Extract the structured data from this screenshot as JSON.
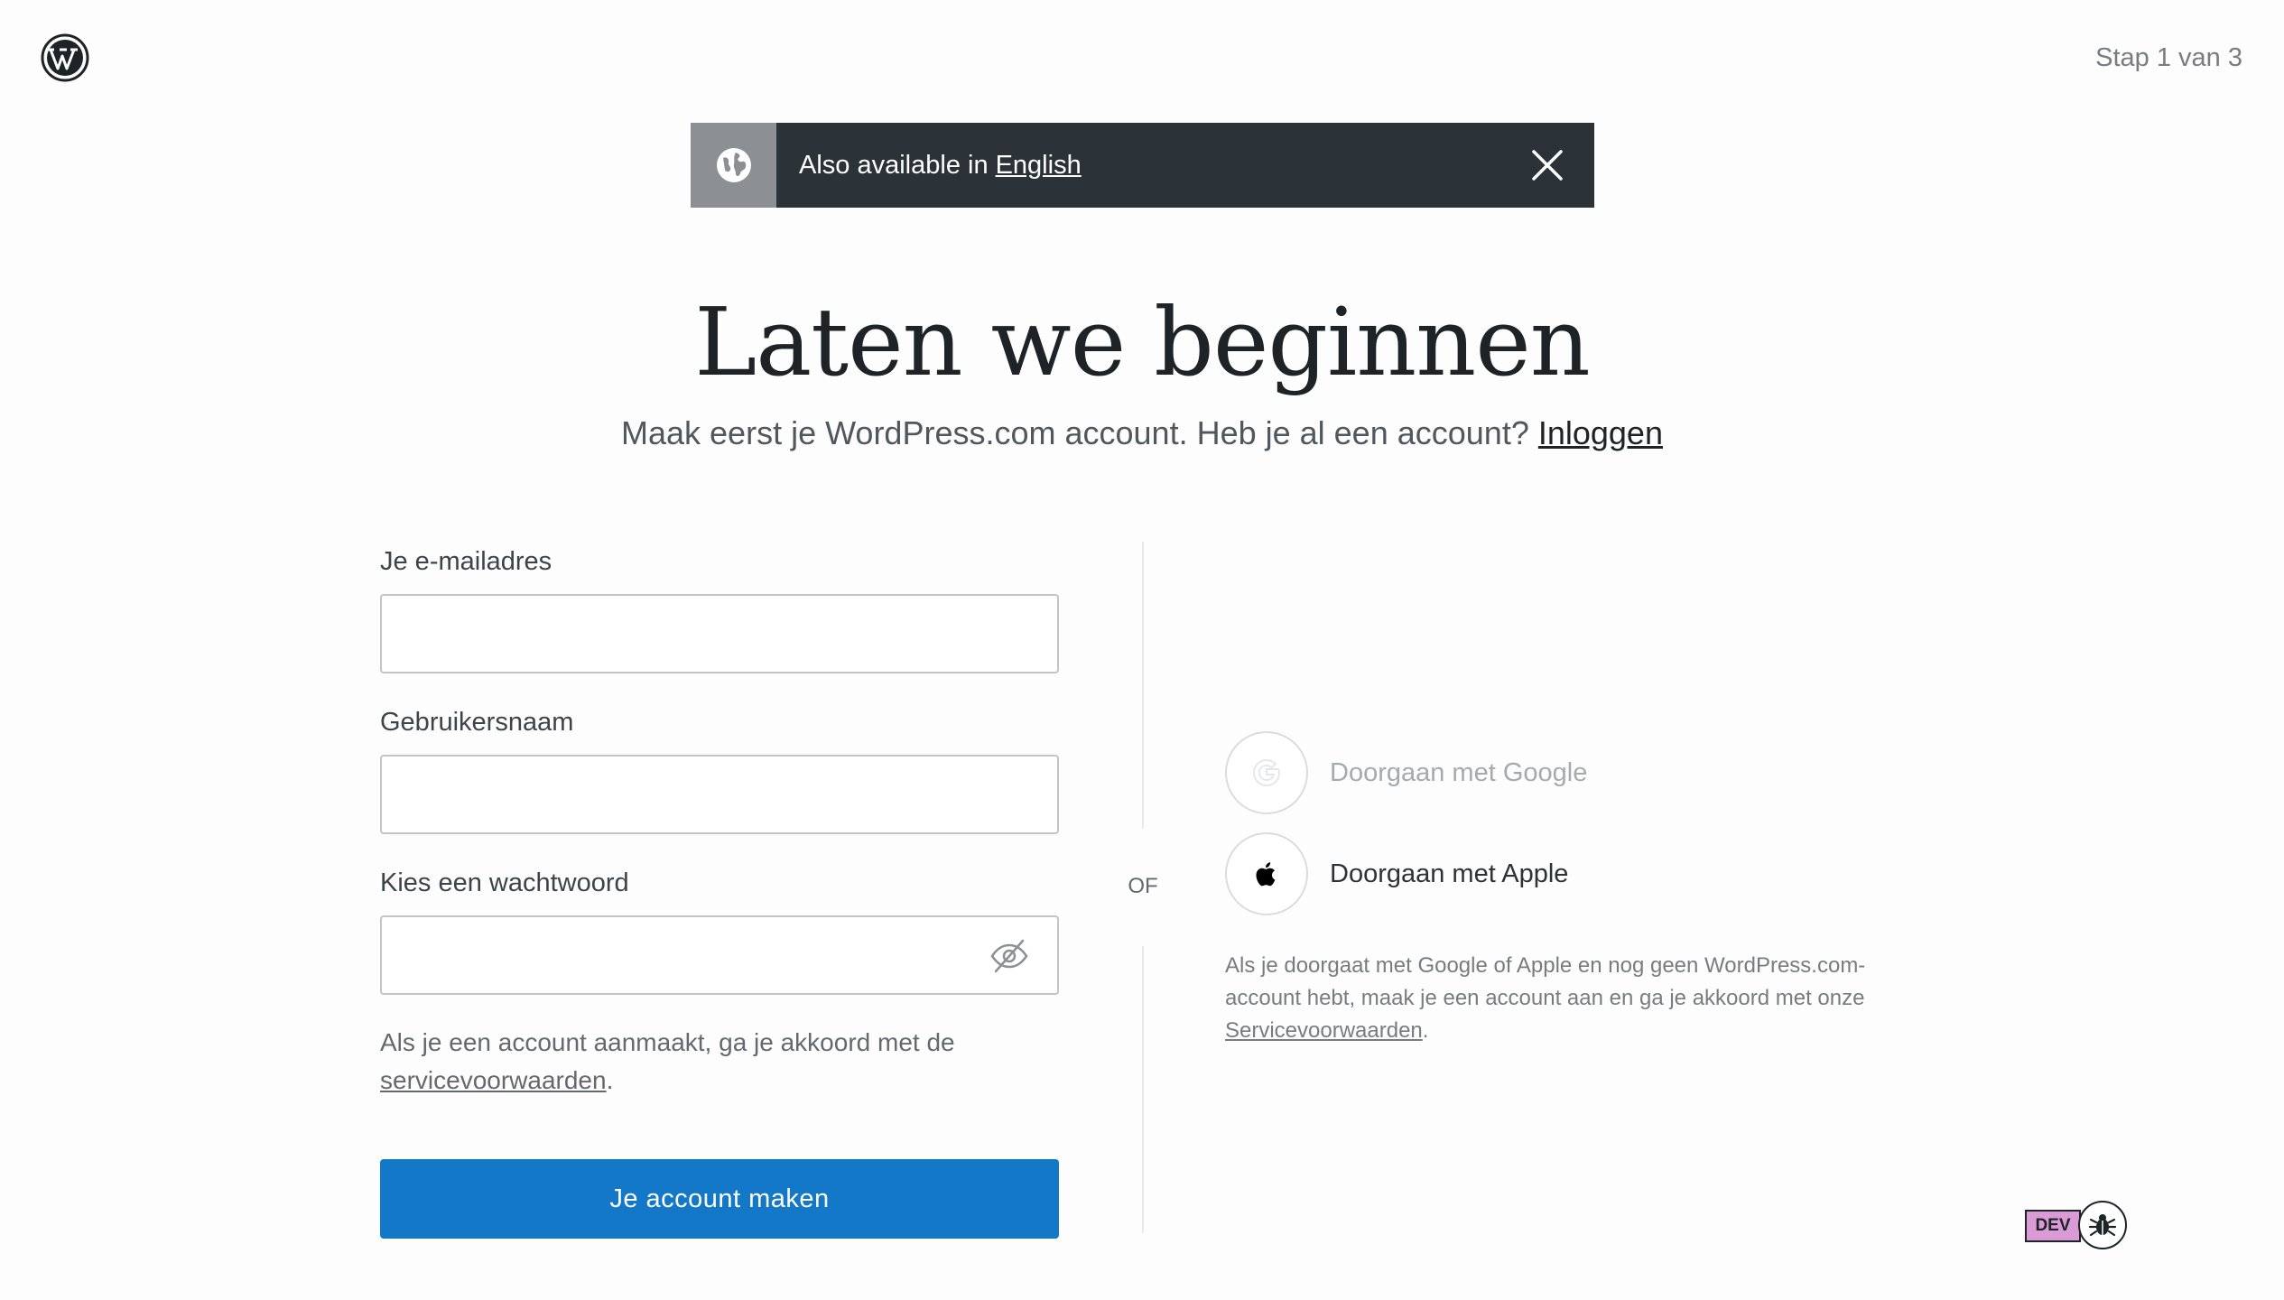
{
  "header": {
    "logo": "wordpress-logo-icon",
    "step_text": "Stap 1 van 3"
  },
  "banner": {
    "text": "Also available in",
    "link_text": "English",
    "icon": "globe-icon",
    "close_icon": "close-icon"
  },
  "main": {
    "title": "Laten we beginnen",
    "subtitle": "Maak eerst je WordPress.com account. Heb je al een account?",
    "login_link": "Inloggen"
  },
  "form": {
    "email_label": "Je e-mailadres",
    "email_value": "",
    "username_label": "Gebruikersnaam",
    "username_value": "",
    "password_label": "Kies een wachtwoord",
    "password_value": "",
    "password_toggle_icon": "eye-slash-icon",
    "terms_text": "Als je een account aanmaakt, ga je akkoord met de",
    "terms_link": "servicevoorwaarden",
    "terms_suffix": ".",
    "submit_label": "Je account maken"
  },
  "divider": {
    "label": "OF"
  },
  "social": {
    "google_label": "Doorgaan met Google",
    "apple_label": "Doorgaan met Apple",
    "note_text": "Als je doorgaat met Google of Apple en nog geen WordPress.com-account hebt, maak je een account aan en ga je akkoord met onze",
    "note_link": "Servicevoorwaarden",
    "note_suffix": "."
  },
  "dev": {
    "badge": "DEV",
    "bug_icon": "bug-icon"
  },
  "colors": {
    "primary_button": "#1478c8",
    "banner_bg": "#2c3338",
    "banner_icon_bg": "#8c8f94",
    "dev_badge": "#d99ad6"
  }
}
